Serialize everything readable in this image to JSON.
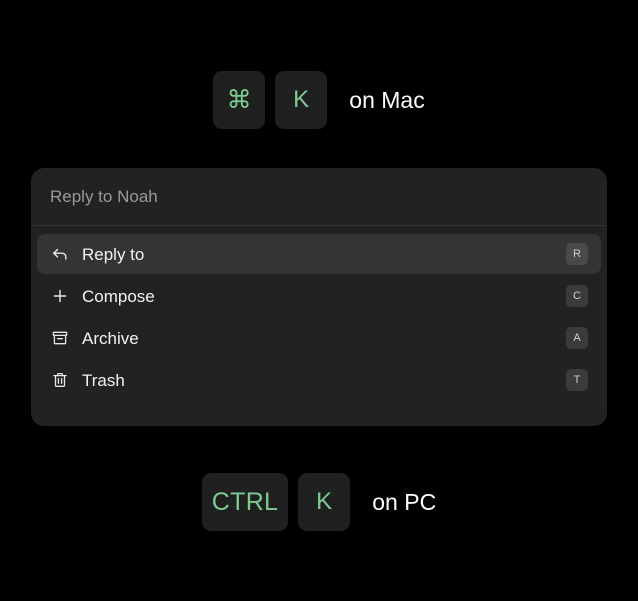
{
  "mac_shortcut": {
    "keys": [
      {
        "name": "command-key",
        "label": "⌘"
      },
      {
        "name": "k-key",
        "label": "K"
      }
    ],
    "platform_label": "on Mac"
  },
  "pc_shortcut": {
    "keys": [
      {
        "name": "ctrl-key",
        "label": "CTRL"
      },
      {
        "name": "k-key",
        "label": "K"
      }
    ],
    "platform_label": "on PC"
  },
  "palette": {
    "header_title": "Reply to Noah",
    "items": [
      {
        "label": "Reply to",
        "shortcut": "R",
        "icon": "reply-arrow-icon",
        "selected": true
      },
      {
        "label": "Compose",
        "shortcut": "C",
        "icon": "plus-icon",
        "selected": false
      },
      {
        "label": "Archive",
        "shortcut": "A",
        "icon": "archive-box-icon",
        "selected": false
      },
      {
        "label": "Trash",
        "shortcut": "T",
        "icon": "trash-can-icon",
        "selected": false
      }
    ]
  },
  "colors": {
    "background": "#000000",
    "panel": "#222222",
    "selected_row": "#343434",
    "keycap": "#1e211f",
    "key_text_green": "#7ecb92",
    "label_white": "#ffffff",
    "muted_text": "#9a9a9a",
    "badge": "#3b3b3b"
  }
}
